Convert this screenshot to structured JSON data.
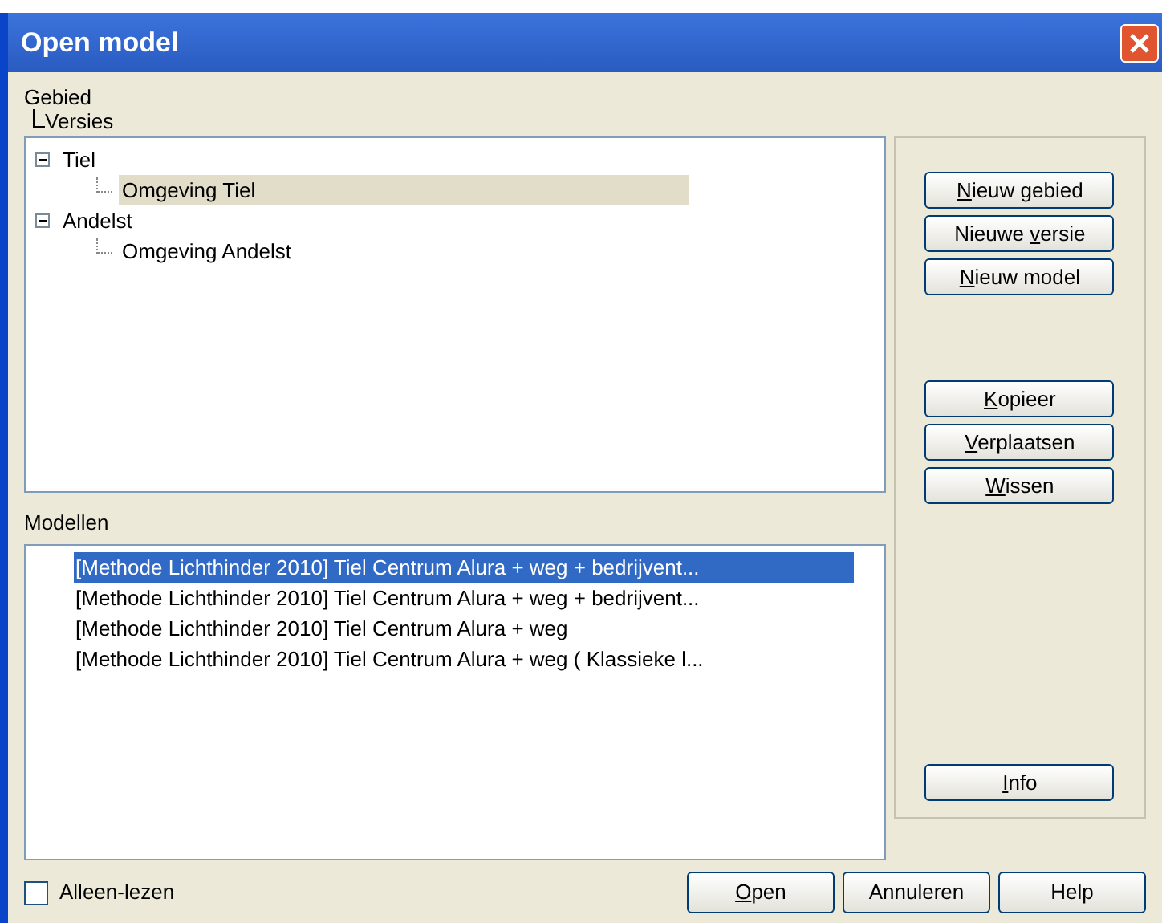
{
  "window": {
    "title": "Open model"
  },
  "tree_header": {
    "line_1": "Gebied",
    "line_2": "Versies"
  },
  "tree": [
    {
      "label": "Tiel",
      "expanded": true,
      "selected": false,
      "children": [
        {
          "label": "Omgeving Tiel",
          "selected": true
        }
      ]
    },
    {
      "label": "Andelst",
      "expanded": true,
      "selected": false,
      "children": [
        {
          "label": "Omgeving Andelst",
          "selected": false
        }
      ]
    }
  ],
  "side_buttons_top": [
    {
      "key": "N",
      "after": "ieuw gebied"
    },
    {
      "before": "Nieuwe ",
      "key": "v",
      "after": "ersie"
    },
    {
      "key": "N",
      "after": "ieuw model"
    }
  ],
  "side_buttons_middle": [
    {
      "key": "K",
      "after": "opieer"
    },
    {
      "key": "V",
      "after": "erplaatsen"
    },
    {
      "key": "W",
      "after": "issen"
    }
  ],
  "side_buttons_bottom": [
    {
      "key": "I",
      "after": "nfo"
    }
  ],
  "models": {
    "label": "Modellen",
    "items": [
      {
        "label": "[Methode Lichthinder 2010] Tiel Centrum Alura + weg + bedrijvent...",
        "selected": true
      },
      {
        "label": "[Methode Lichthinder 2010] Tiel Centrum Alura + weg + bedrijvent...",
        "selected": false
      },
      {
        "label": "[Methode Lichthinder 2010] Tiel Centrum Alura + weg",
        "selected": false
      },
      {
        "label": "[Methode Lichthinder 2010] Tiel Centrum Alura + weg ( Klassieke l...",
        "selected": false
      }
    ]
  },
  "read_only": {
    "label": "Alleen-lezen",
    "checked": false
  },
  "footer_buttons": [
    {
      "key": "O",
      "after": "pen"
    },
    {
      "before": "Annuleren"
    },
    {
      "before": "Help"
    }
  ]
}
